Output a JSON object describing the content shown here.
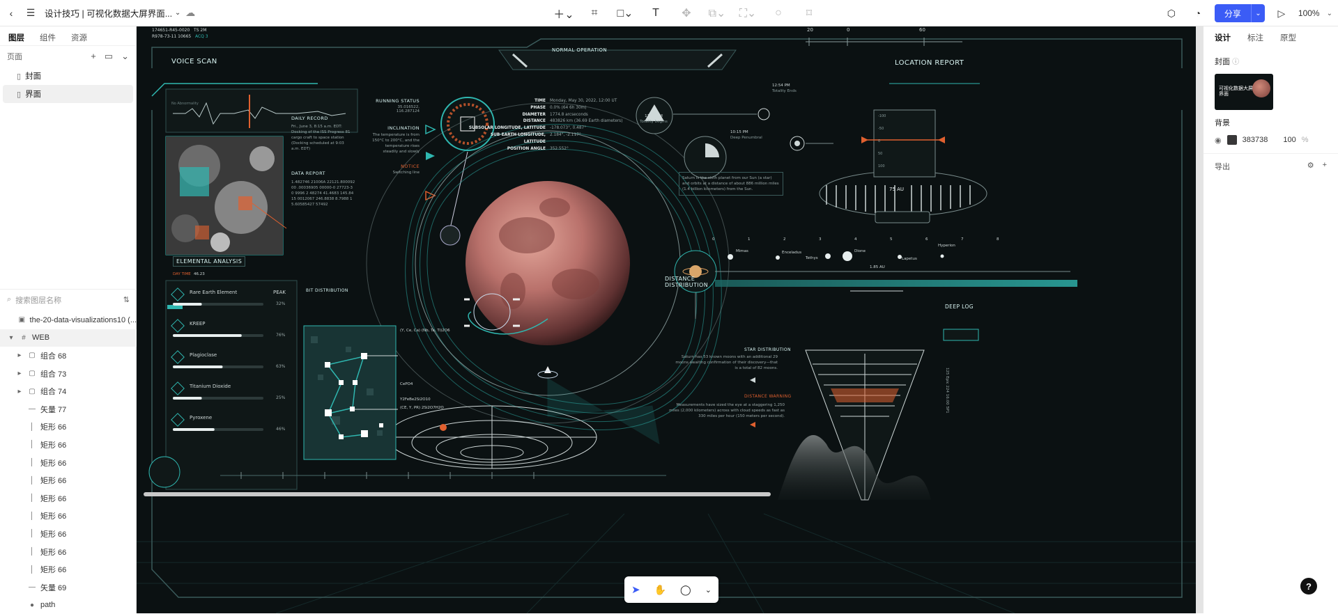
{
  "topbar": {
    "title": "设计技巧 | 可视化数据大屏界面...",
    "share_label": "分享",
    "zoom": "100%"
  },
  "left_panel": {
    "tabs": [
      "图层",
      "组件",
      "资源"
    ],
    "pages_label": "页面",
    "pages": [
      "封面",
      "界面"
    ],
    "search_placeholder": "搜索图层名称",
    "layers": [
      {
        "label": "the-20-data-visualizations10 (...",
        "icon": "image-icon",
        "level": 0
      },
      {
        "label": "WEB",
        "icon": "frame-icon",
        "level": 0
      },
      {
        "label": "组合 68",
        "icon": "group-icon",
        "level": 1
      },
      {
        "label": "组合 73",
        "icon": "group-icon",
        "level": 1
      },
      {
        "label": "组合 74",
        "icon": "group-icon",
        "level": 1
      },
      {
        "label": "矢量 77",
        "icon": "vector-icon",
        "level": 1
      },
      {
        "label": "矩形 66",
        "icon": "rect-icon",
        "level": 1
      },
      {
        "label": "矩形 66",
        "icon": "rect-icon",
        "level": 1
      },
      {
        "label": "矩形 66",
        "icon": "rect-icon",
        "level": 1
      },
      {
        "label": "矩形 66",
        "icon": "rect-icon",
        "level": 1
      },
      {
        "label": "矩形 66",
        "icon": "rect-icon",
        "level": 1
      },
      {
        "label": "矩形 66",
        "icon": "rect-icon",
        "level": 1
      },
      {
        "label": "矩形 66",
        "icon": "rect-icon",
        "level": 1
      },
      {
        "label": "矩形 66",
        "icon": "rect-icon",
        "level": 1
      },
      {
        "label": "矩形 66",
        "icon": "rect-icon",
        "level": 1
      },
      {
        "label": "矢量 69",
        "icon": "vector-icon",
        "level": 1
      },
      {
        "label": "path",
        "icon": "path-icon",
        "level": 1
      }
    ]
  },
  "right_panel": {
    "tabs": [
      "设计",
      "标注",
      "原型"
    ],
    "cover_label": "封面",
    "cover_thumb_text": "可视化数据大屏界面",
    "bg_label": "背景",
    "bg_hex": "383738",
    "bg_opacity": "100",
    "bg_unit": "%",
    "export_label": "导出"
  },
  "dashboard": {
    "top_left_ids": [
      "174651-R45-0020",
      "TS 2M",
      "R978-73-11 10665",
      "ACQ 3"
    ],
    "normal_operation": "NORMAL OPERATION",
    "scale_top": [
      "20",
      "0",
      "60"
    ],
    "voice_scan": "VOICE SCAN",
    "voice_scan_sub": "No Abnormality",
    "daily_record_title": "DAILY RECORD",
    "daily_record_text": "Fri., June 3, 8:15 a.m. EDT: Docking of the ISS Progress 81 cargo craft to space station (Docking scheduled at 9:03 a.m. EDT)",
    "data_report_title": "DATA REPORT",
    "data_report_text": "1.482746 21006A 22121.80009200 .00036905 00000-0 27723-3 0 9996 2 48274 41.4683 145.8415 0012067 246.8838 8.7988 15.60585427 57492",
    "running_status": "RUNNING STATUS",
    "running_status_val": "35.016522, 116.287124",
    "inclination": "INCLINATION",
    "inclination_text": "The temperature is from 150°C to 200°C, and the temperature rises steadily and slowly",
    "notice": "NOTICE",
    "notice_text": "Switching line",
    "info_rows": [
      {
        "k": "TIME",
        "v": "Monday, May 30, 2022, 12:00 UT"
      },
      {
        "k": "PHASE",
        "v": "0.0% (64 6h 30m)"
      },
      {
        "k": "DIAMETER",
        "v": "1774.8 arcseconds"
      },
      {
        "k": "DISTANCE",
        "v": "483826 km (36.69 Earth diameters)"
      },
      {
        "k": "SUBSOLAR LONGITUDE, LATITUDE",
        "v": "-178.073°, 0.487°"
      },
      {
        "k": "SUB-EARTH LONGITUDE, LATITUDE",
        "v": "2.184°, -2.117°"
      },
      {
        "k": "POSITION ANGLE",
        "v": "352.552°"
      }
    ],
    "location_report": "LOCATION REPORT",
    "events": [
      {
        "time": "12:54 PM",
        "text": "Totality Ends"
      },
      {
        "time": "11:29 PM",
        "text": "Totality begins"
      },
      {
        "time": "10:15 PM",
        "text": "Deep Penumbral"
      }
    ],
    "saturn_note": "Saturn is the sixth planet from our Sun (a star) and orbits at a distance of about 886 million miles (1.4 billion kilometers) from the Sun.",
    "au_value": "75 AU",
    "gauge_ticks": [
      "-100",
      "-50",
      "0",
      "50",
      "100"
    ],
    "distance_distribution": "DISTANCE DISTRIBUTION",
    "moons": [
      "Mimas",
      "Enceladus",
      "Tethys",
      "Dione",
      "Lapetus",
      "Hyperion"
    ],
    "distance_axis": [
      "0",
      "1",
      "2",
      "3",
      "4",
      "5",
      "6",
      "7",
      "8"
    ],
    "distance_span": "1.85 AU",
    "elemental_analysis": "ELEMENTAL ANALYSIS",
    "day_time_label": "DAY TIME",
    "day_time_val": "46.23",
    "peak_label": "PEAK",
    "elements": [
      {
        "name": "Rare Earth Element",
        "pct_label": "32%",
        "fill": 0.32
      },
      {
        "name": "KREEP",
        "pct_label": "76%",
        "fill": 0.76
      },
      {
        "name": "Plagioclase",
        "pct_label": "63%",
        "fill": 0.55
      },
      {
        "name": "Titanium Dioxide",
        "pct_label": "25%",
        "fill": 0.32
      },
      {
        "name": "Pyroxene",
        "pct_label": "46%",
        "fill": 0.46
      }
    ],
    "bit_distribution": "BIT DISTRIBUTION",
    "bit_labels": [
      "(Y, Ce, Ca) (Nb, Ta, Ti)2O6",
      "CePO4",
      "Y2FeBe2Si2O10",
      "(CE, Y, PR) 2Si2O7H2O"
    ],
    "deep_log": "DEEP LOG",
    "star_distribution": "STAR DISTRIBUTION",
    "star_text": "Saturn has 53 known moons with an additional 29 moons awaiting confirmation of their discovery—that is a total of 82 moons.",
    "distance_warning": "DISTANCE WARNING",
    "warning_text": "Measurements have sized the eye at a staggering 1,250 miles (2,000 kilometers) across with cloud speeds as fast as 330 miles per hour (150 meters per second).",
    "side_vertical": "125 Epic 224 16:00 5P1",
    "colors": {
      "teal": "#2fb7b0",
      "orange": "#e0602f",
      "bg": "#0b1112",
      "planet": "#b9716b"
    }
  }
}
